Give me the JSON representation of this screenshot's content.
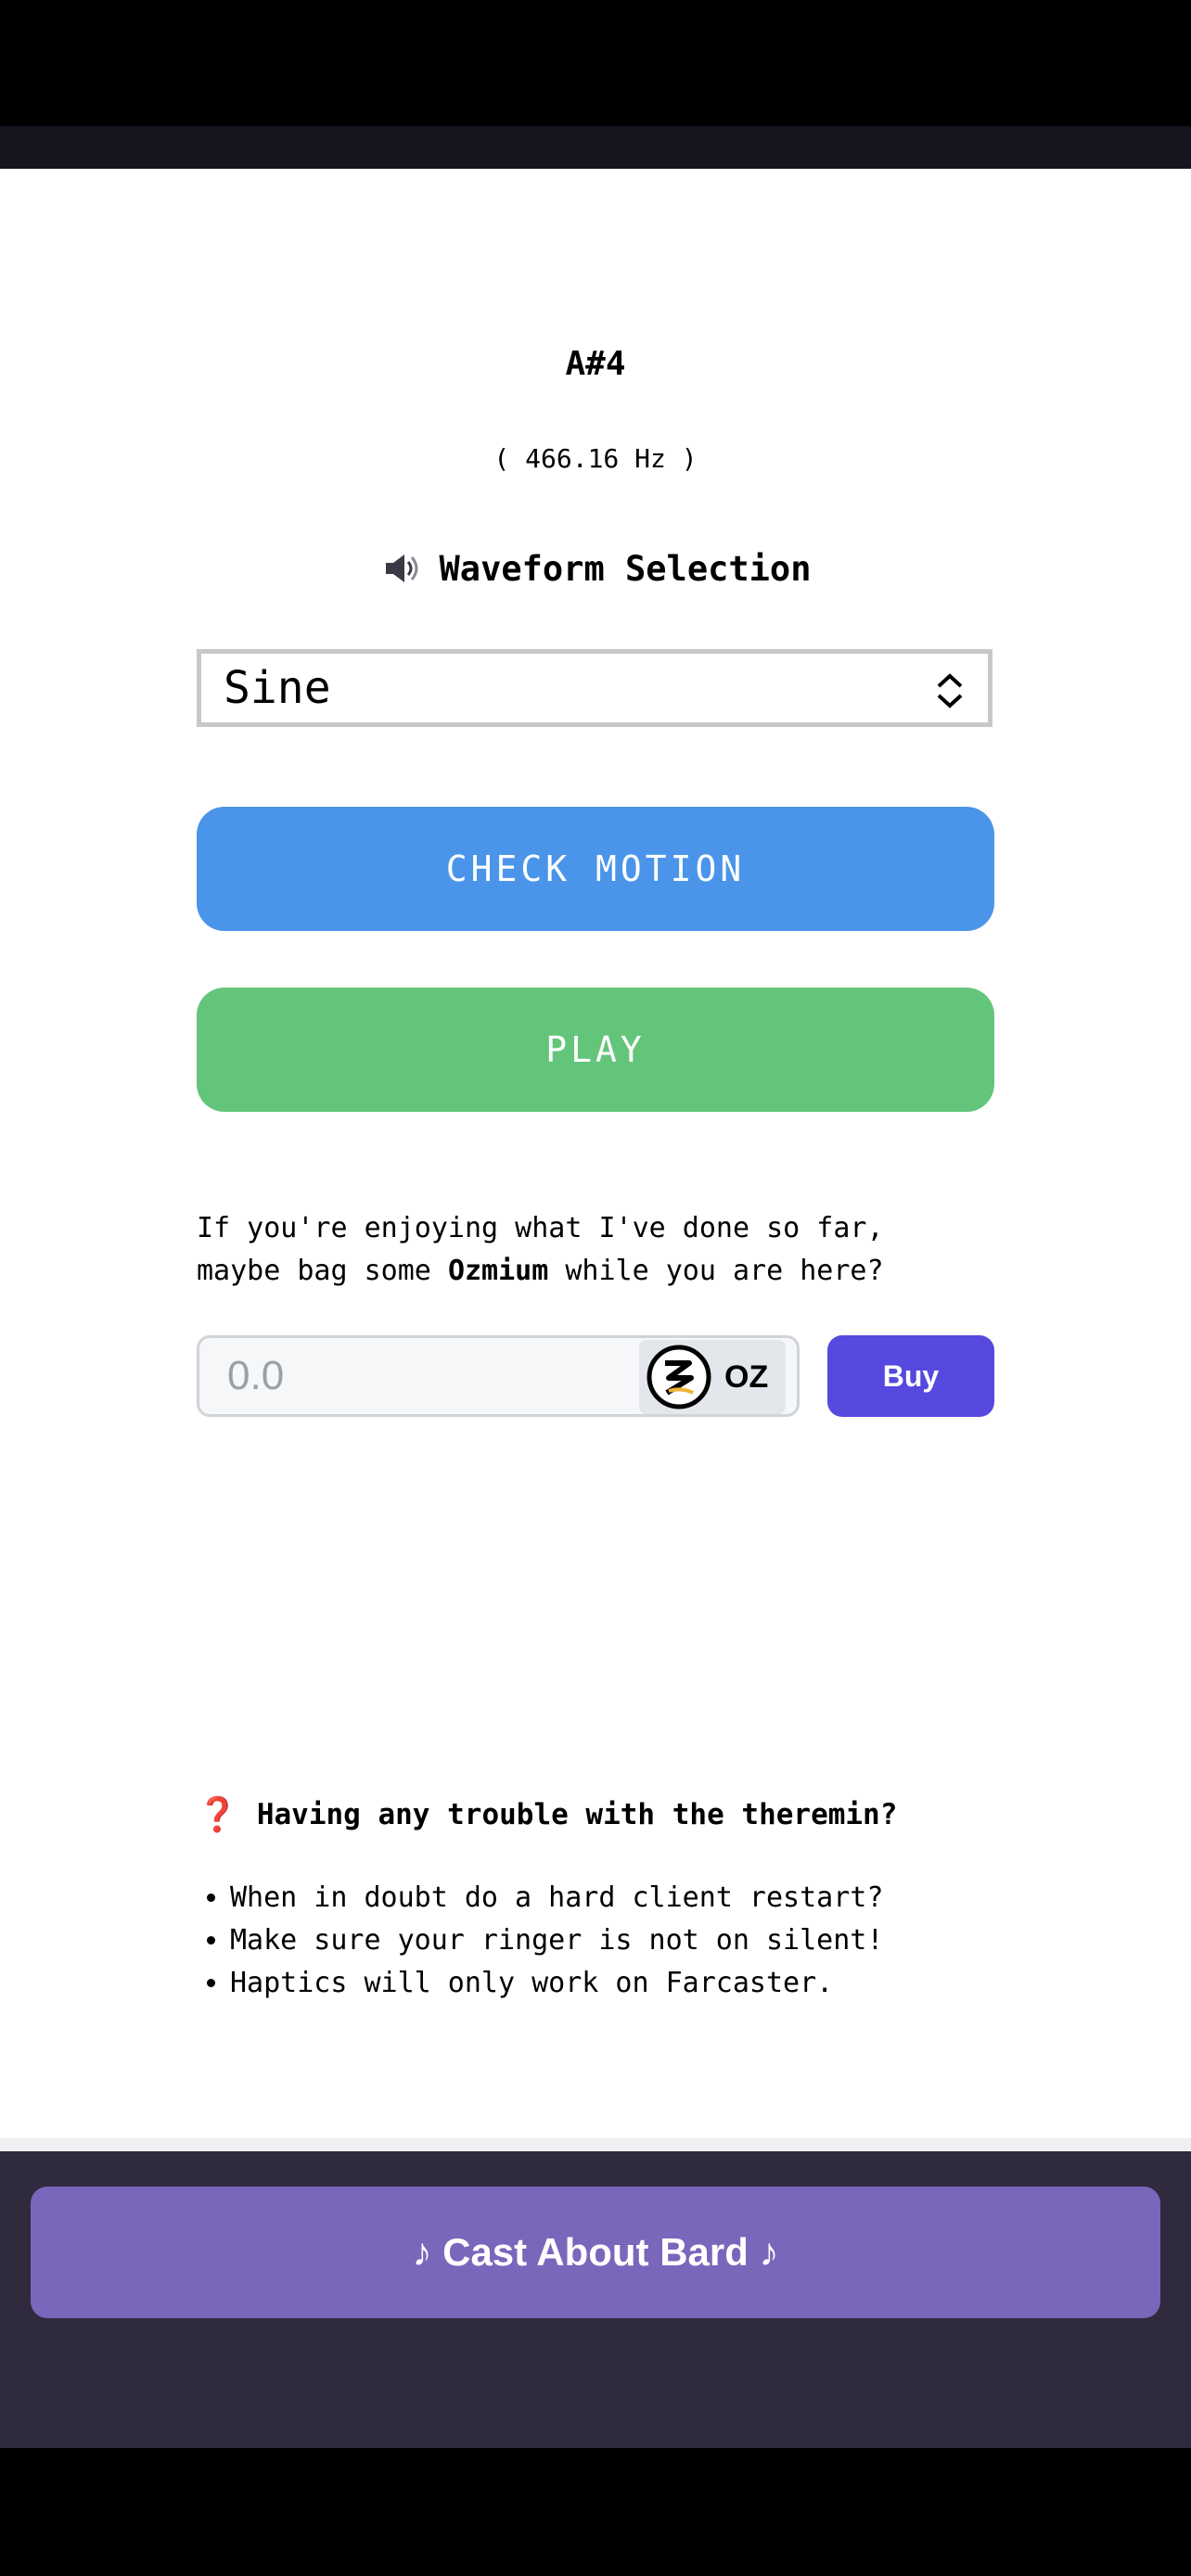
{
  "note": {
    "name": "A#4",
    "frequency": "( 466.16 Hz )"
  },
  "waveform": {
    "heading": "Waveform Selection",
    "icon": "speaker-icon",
    "selected": "Sine"
  },
  "buttons": {
    "check_motion": "CHECK MOTION",
    "play": "PLAY"
  },
  "promo": {
    "line1": "If you're enjoying what I've done so far,",
    "line2_prefix": "maybe bag some ",
    "token_name": "Ozmium",
    "line2_suffix": " while you are here?"
  },
  "purchase": {
    "amount_placeholder": "0.0",
    "token_symbol": "OZ",
    "buy_label": "Buy"
  },
  "help": {
    "icon_glyph": "❓",
    "heading": "Having any trouble with the theremin?",
    "tips": [
      "When in doubt do a hard client restart?",
      "Make sure your ringer is not on silent!",
      "Haptics will only work on Farcaster."
    ]
  },
  "footer": {
    "cast_label": "♪ Cast About Bard ♪"
  },
  "colors": {
    "check_motion": "#4a95ea",
    "play": "#63c57a",
    "buy": "#5549df",
    "cast": "#7a66bb",
    "footer_bg": "#2f2a3d"
  }
}
